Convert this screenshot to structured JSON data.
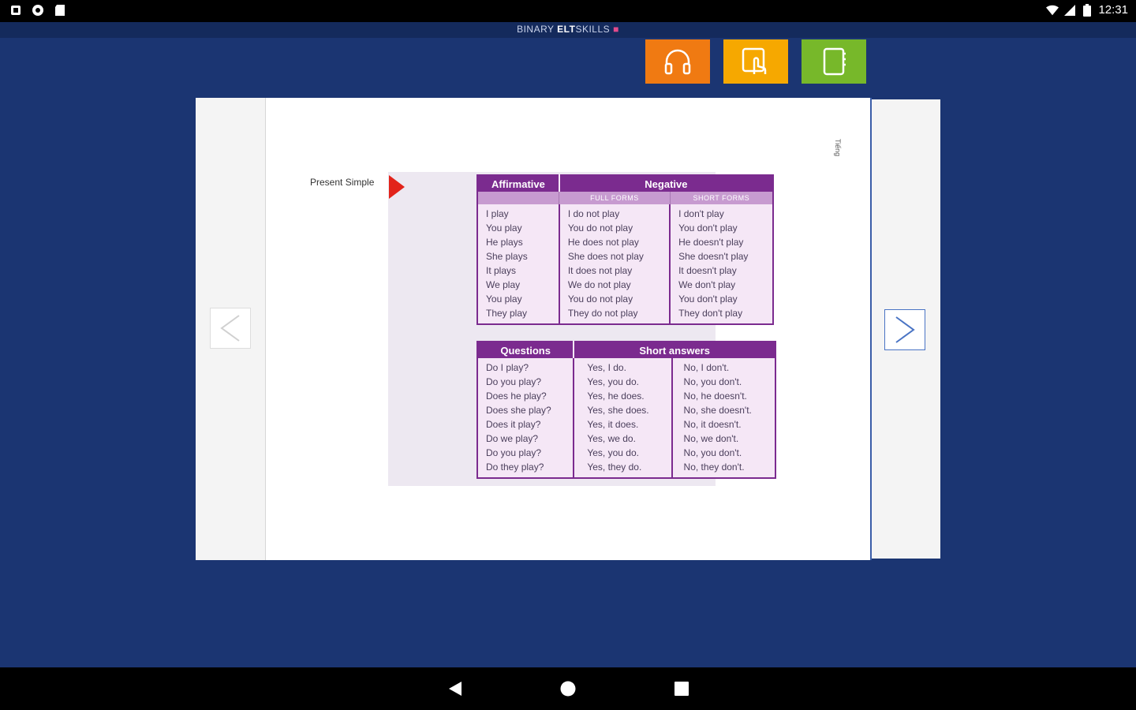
{
  "status_bar": {
    "time": "12:31",
    "left_icons": [
      "notification-icon",
      "sync-icon",
      "sd-card-icon"
    ],
    "right_icons": [
      "wifi-icon",
      "signal-icon",
      "battery-icon"
    ]
  },
  "app": {
    "brand_part1": "BINARY",
    "brand_part2": "ELT",
    "brand_part3": "SKILLS",
    "accent_colors": {
      "audio": "#f07a12",
      "touch": "#f6a800",
      "book": "#77b82a",
      "background": "#1b3572"
    }
  },
  "toolbar": {
    "buttons": [
      {
        "icon": "headphones-icon"
      },
      {
        "icon": "touch-icon"
      },
      {
        "icon": "notebook-icon"
      }
    ]
  },
  "page": {
    "side_text": "Tiếng",
    "section_label": "Present Simple",
    "table1": {
      "headers": [
        "Affirmative",
        "Negative"
      ],
      "subheaders": [
        "FULL FORMS",
        "SHORT FORMS"
      ],
      "affirmative": [
        "I play",
        "You play",
        "He plays",
        "She plays",
        "It plays",
        "We play",
        "You play",
        "They play"
      ],
      "negative_full": [
        "I do not play",
        "You do not play",
        "He does not play",
        "She does not play",
        "It does not play",
        "We do not play",
        "You do not play",
        "They do not play"
      ],
      "negative_short": [
        "I don't play",
        "You don't play",
        "He doesn't play",
        "She doesn't play",
        "It doesn't play",
        "We don't play",
        "You don't play",
        "They don't play"
      ]
    },
    "table2": {
      "headers": [
        "Questions",
        "Short answers"
      ],
      "questions": [
        "Do I play?",
        "Do you play?",
        "Does he play?",
        "Does she play?",
        "Does it play?",
        "Do we play?",
        "Do you play?",
        "Do they play?"
      ],
      "yes": [
        "Yes, I do.",
        "Yes, you do.",
        "Yes, he does.",
        "Yes, she does.",
        "Yes, it does.",
        "Yes, we do.",
        "Yes, you do.",
        "Yes, they do."
      ],
      "no": [
        "No, I don't.",
        "No, you don't.",
        "No, he doesn't.",
        "No, she doesn't.",
        "No, it doesn't.",
        "No, we don't.",
        "No, you don't.",
        "No, they don't."
      ]
    }
  },
  "navigation": {
    "prev_icon": "chevron-left-icon",
    "next_icon": "chevron-right-icon"
  },
  "system_nav": [
    "back-icon",
    "home-icon",
    "recents-icon"
  ]
}
